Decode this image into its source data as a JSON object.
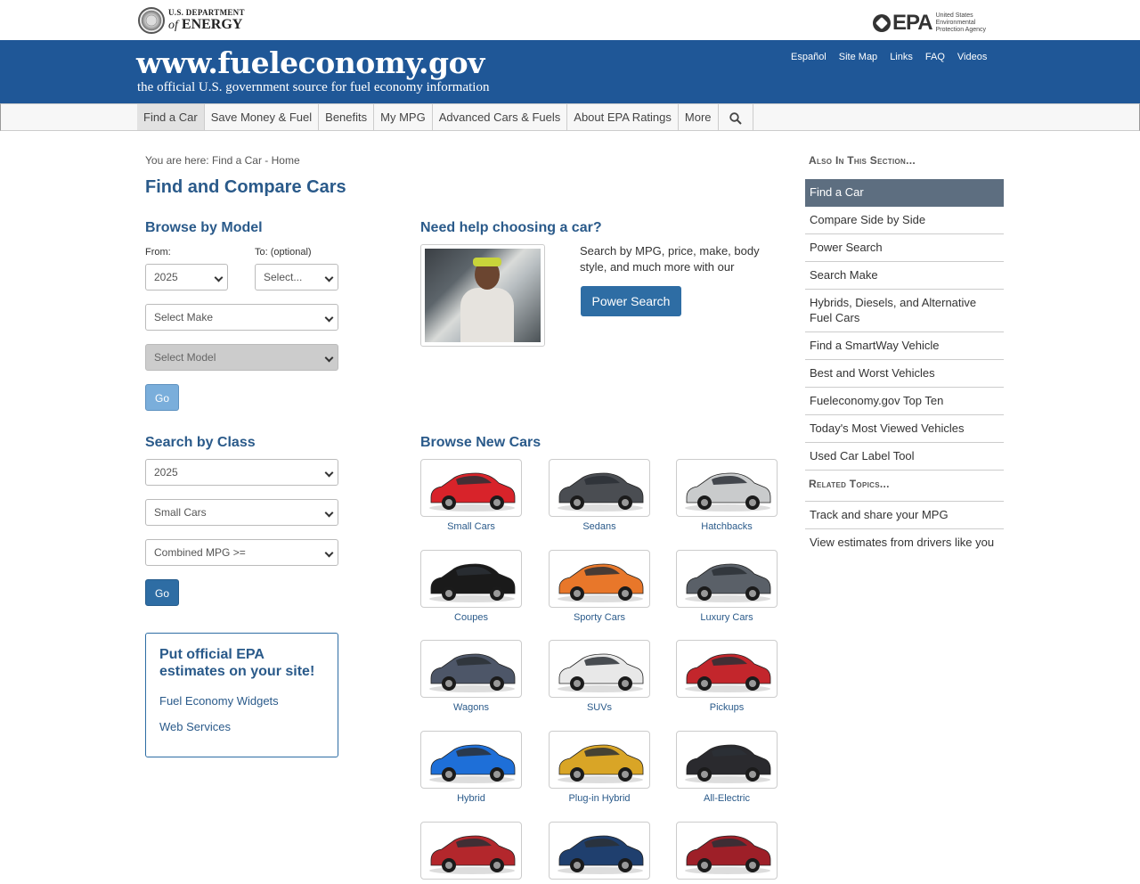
{
  "agency": {
    "doe_line1": "U.S. DEPARTMENT",
    "doe_line2_prefix": "of",
    "doe_line2": "ENERGY",
    "epa_word": "EPA",
    "epa_sub": "United States Environmental Protection Agency"
  },
  "banner": {
    "title": "www.fueleconomy.gov",
    "tagline": "the official U.S. government source for fuel economy information",
    "util_links": [
      "Español",
      "Site Map",
      "Links",
      "FAQ",
      "Videos"
    ]
  },
  "nav": {
    "items": [
      "Find a Car",
      "Save Money & Fuel",
      "Benefits",
      "My MPG",
      "Advanced Cars & Fuels",
      "About EPA Ratings",
      "More"
    ],
    "active": "Find a Car"
  },
  "main": {
    "breadcrumb": "You are here: Find a Car - Home",
    "title": "Find and Compare Cars",
    "browse_model": {
      "heading": "Browse by Model",
      "from_label": "From:",
      "to_label": "To: (optional)",
      "from_value": "2025",
      "to_value": "Select...",
      "make_value": "Select Make",
      "model_value": "Select Model",
      "go_label": "Go"
    },
    "search_class": {
      "heading": "Search by Class",
      "year_value": "2025",
      "class_value": "Small Cars",
      "mpg_value": "Combined MPG >=",
      "go_label": "Go"
    },
    "widget_box": {
      "title": "Put official EPA estimates on your site!",
      "links": [
        "Fuel Economy Widgets",
        "Web Services"
      ]
    },
    "help": {
      "heading": "Need help choosing a car?",
      "text": "Search by MPG, price, make, body style, and much more with our",
      "button": "Power Search"
    },
    "browse_new": {
      "heading": "Browse New Cars",
      "cars": [
        {
          "label": "Small Cars",
          "color": "#d8232a"
        },
        {
          "label": "Sedans",
          "color": "#4a4d52"
        },
        {
          "label": "Hatchbacks",
          "color": "#c9cbcc"
        },
        {
          "label": "Coupes",
          "color": "#1a1a1a"
        },
        {
          "label": "Sporty Cars",
          "color": "#e8772a"
        },
        {
          "label": "Luxury Cars",
          "color": "#5a6068"
        },
        {
          "label": "Wagons",
          "color": "#4d5668"
        },
        {
          "label": "SUVs",
          "color": "#e8e8e8"
        },
        {
          "label": "Pickups",
          "color": "#c3262c"
        },
        {
          "label": "Hybrid",
          "color": "#1e6fd8"
        },
        {
          "label": "Plug-in Hybrid",
          "color": "#d9a526"
        },
        {
          "label": "All-Electric",
          "color": "#2a2a2e"
        },
        {
          "label": "",
          "color": "#b3272c"
        },
        {
          "label": "",
          "color": "#1f3f6e"
        },
        {
          "label": "",
          "color": "#9e1f28"
        }
      ]
    }
  },
  "sidebar": {
    "section_heading": "Also In This Section...",
    "items": [
      "Find a Car",
      "Compare Side by Side",
      "Power Search",
      "Search Make",
      "Hybrids, Diesels, and Alternative Fuel Cars",
      "Find a SmartWay Vehicle",
      "Best and Worst Vehicles",
      "Fueleconomy.gov Top Ten",
      "Today's Most Viewed Vehicles",
      "Used Car Label Tool"
    ],
    "related_heading": "Related Topics...",
    "related": [
      "Track and share your MPG",
      "View estimates from drivers like you"
    ]
  }
}
